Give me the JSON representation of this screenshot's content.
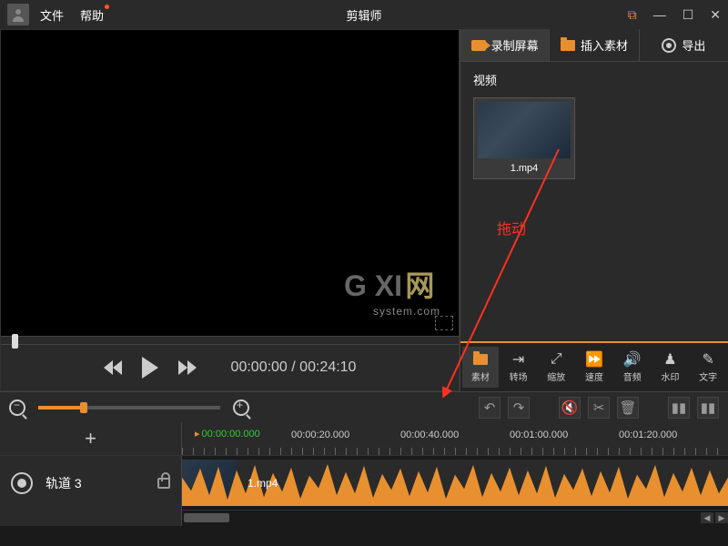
{
  "titlebar": {
    "menu_file": "文件",
    "menu_help": "帮助",
    "app_title": "剪辑师"
  },
  "preview": {
    "watermark_main": "G XI",
    "watermark_net": "网",
    "watermark_sub": "system.com",
    "time_current": "00:00:00",
    "time_sep": " / ",
    "time_total": "00:24:10"
  },
  "right": {
    "action_record": "录制屏幕",
    "action_import": "插入素材",
    "action_export": "导出",
    "section_title": "视频",
    "clip_name": "1.mp4",
    "drag_hint": "拖动",
    "tabs": {
      "material": "素材",
      "transition": "转场",
      "scale": "缩放",
      "speed": "速度",
      "audio": "音频",
      "watermark": "水印",
      "text": "文字"
    }
  },
  "timeline": {
    "playhead": "00:00:00.000",
    "marks": [
      "00:00:20.000",
      "00:00:40.000",
      "00:01:00.000",
      "00:01:20.000"
    ],
    "track_name": "轨道 3",
    "clip_name": "1.mp4"
  }
}
